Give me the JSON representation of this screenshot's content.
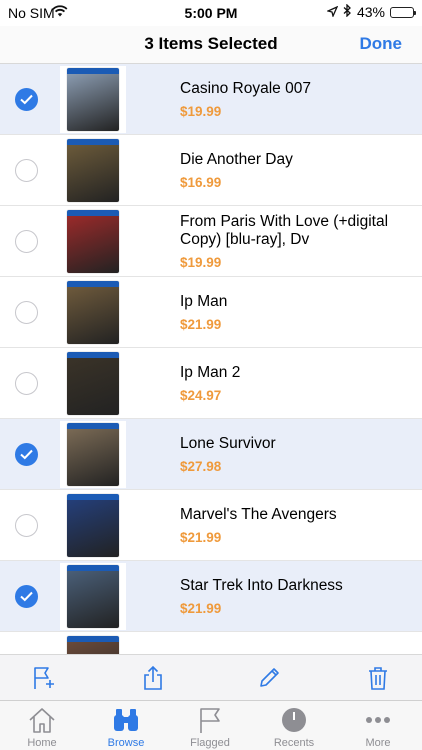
{
  "status_bar": {
    "carrier": "No SIM",
    "time": "5:00 PM",
    "battery": "43%",
    "battery_level": 0.43
  },
  "nav": {
    "title": "3 Items Selected",
    "done_label": "Done"
  },
  "colors": {
    "accent": "#2f7ae5",
    "price": "#ef9a3c",
    "selected_row": "#e9eef9"
  },
  "items": [
    {
      "name": "Casino Royale 007",
      "price": "$19.99",
      "selected": true,
      "cover": "#8a9bb0"
    },
    {
      "name": "Die Another Day",
      "price": "$16.99",
      "selected": false,
      "cover": "#6b5a3a"
    },
    {
      "name": "From Paris With Love (+digital Copy) [blu-ray], Dv",
      "price": "$19.99",
      "selected": false,
      "cover": "#9a2a2a"
    },
    {
      "name": "Ip Man",
      "price": "$21.99",
      "selected": false,
      "cover": "#6e5a3c"
    },
    {
      "name": "Ip Man 2",
      "price": "$24.97",
      "selected": false,
      "cover": "#3a3328"
    },
    {
      "name": "Lone Survivor",
      "price": "$27.98",
      "selected": true,
      "cover": "#7a6a55"
    },
    {
      "name": "Marvel's The Avengers",
      "price": "$21.99",
      "selected": false,
      "cover": "#243f7a"
    },
    {
      "name": "Star Trek Into Darkness",
      "price": "$21.99",
      "selected": true,
      "cover": "#4a5f78"
    },
    {
      "name": "",
      "price": "",
      "selected": false,
      "cover": "#6a4a3a"
    }
  ],
  "toolbar": {
    "icons": [
      "flag-add-icon",
      "share-icon",
      "pencil-icon",
      "trash-icon"
    ]
  },
  "tabs": [
    {
      "label": "Home",
      "icon": "house-icon",
      "active": false
    },
    {
      "label": "Browse",
      "icon": "binoculars-icon",
      "active": true
    },
    {
      "label": "Flagged",
      "icon": "flag-icon",
      "active": false
    },
    {
      "label": "Recents",
      "icon": "clock-icon",
      "active": false
    },
    {
      "label": "More",
      "icon": "more-dots-icon",
      "active": false
    }
  ]
}
